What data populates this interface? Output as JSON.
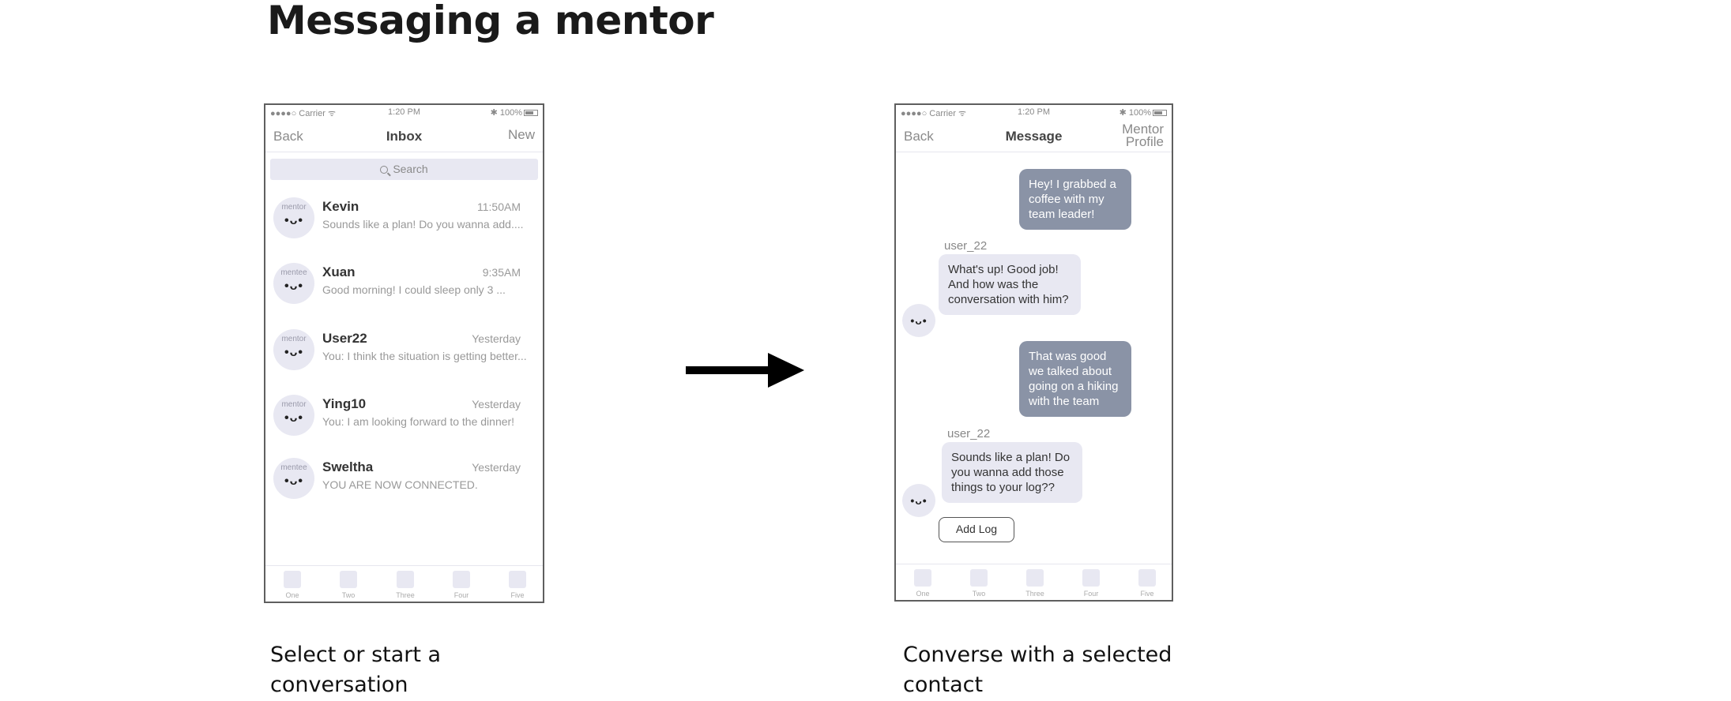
{
  "title": "Messaging a mentor",
  "captions": {
    "left": "Select or start a conversation",
    "right": "Converse with a selected contact"
  },
  "status_bar": {
    "carrier": "●●●●○ Carrier ᯤ",
    "time": "1:20 PM",
    "battery": "✱ 100%"
  },
  "inbox": {
    "back": "Back",
    "title": "Inbox",
    "new": "New",
    "search_placeholder": "Search",
    "conversations": [
      {
        "role": "mentor",
        "face": "•ᴗ•",
        "name": "Kevin",
        "time": "11:50AM",
        "preview": "Sounds like a plan! Do you wanna add...."
      },
      {
        "role": "mentee",
        "face": "•ᴗ•",
        "name": "Xuan",
        "time": "9:35AM",
        "preview": "Good morning! I could sleep only 3 ..."
      },
      {
        "role": "mentor",
        "face": "•ᴗ•",
        "name": "User22",
        "time": "Yesterday",
        "preview": "You: I think the situation is getting better..."
      },
      {
        "role": "mentor",
        "face": "•ᴗ•",
        "name": "Ying10",
        "time": "Yesterday",
        "preview": "You: I am looking forward to the dinner!"
      },
      {
        "role": "mentee",
        "face": "•ᴗ•",
        "name": "Sweltha",
        "time": "Yesterday",
        "preview": "YOU ARE NOW CONNECTED."
      }
    ]
  },
  "message": {
    "back": "Back",
    "title": "Message",
    "mentor_profile": "Mentor Profile",
    "face": "•ᴗ•",
    "bubbles": [
      {
        "type": "out",
        "text": "Hey! I grabbed a coffee with my team leader!"
      },
      {
        "type": "in",
        "sender": "user_22",
        "text": "What's up! Good job! And how was the conversation with him?"
      },
      {
        "type": "out",
        "text": "That was good we talked about going on a hiking with the team"
      },
      {
        "type": "in",
        "sender": "user_22",
        "text": "Sounds like a plan! Do you wanna add those things to your log??"
      }
    ],
    "add_log": "Add Log"
  },
  "tabs": [
    "One",
    "Two",
    "Three",
    "Four",
    "Five"
  ],
  "colors": {
    "outgoing_bubble": "#8a93a6",
    "incoming_bubble": "#e8e8f2",
    "arrow": "#000000"
  }
}
